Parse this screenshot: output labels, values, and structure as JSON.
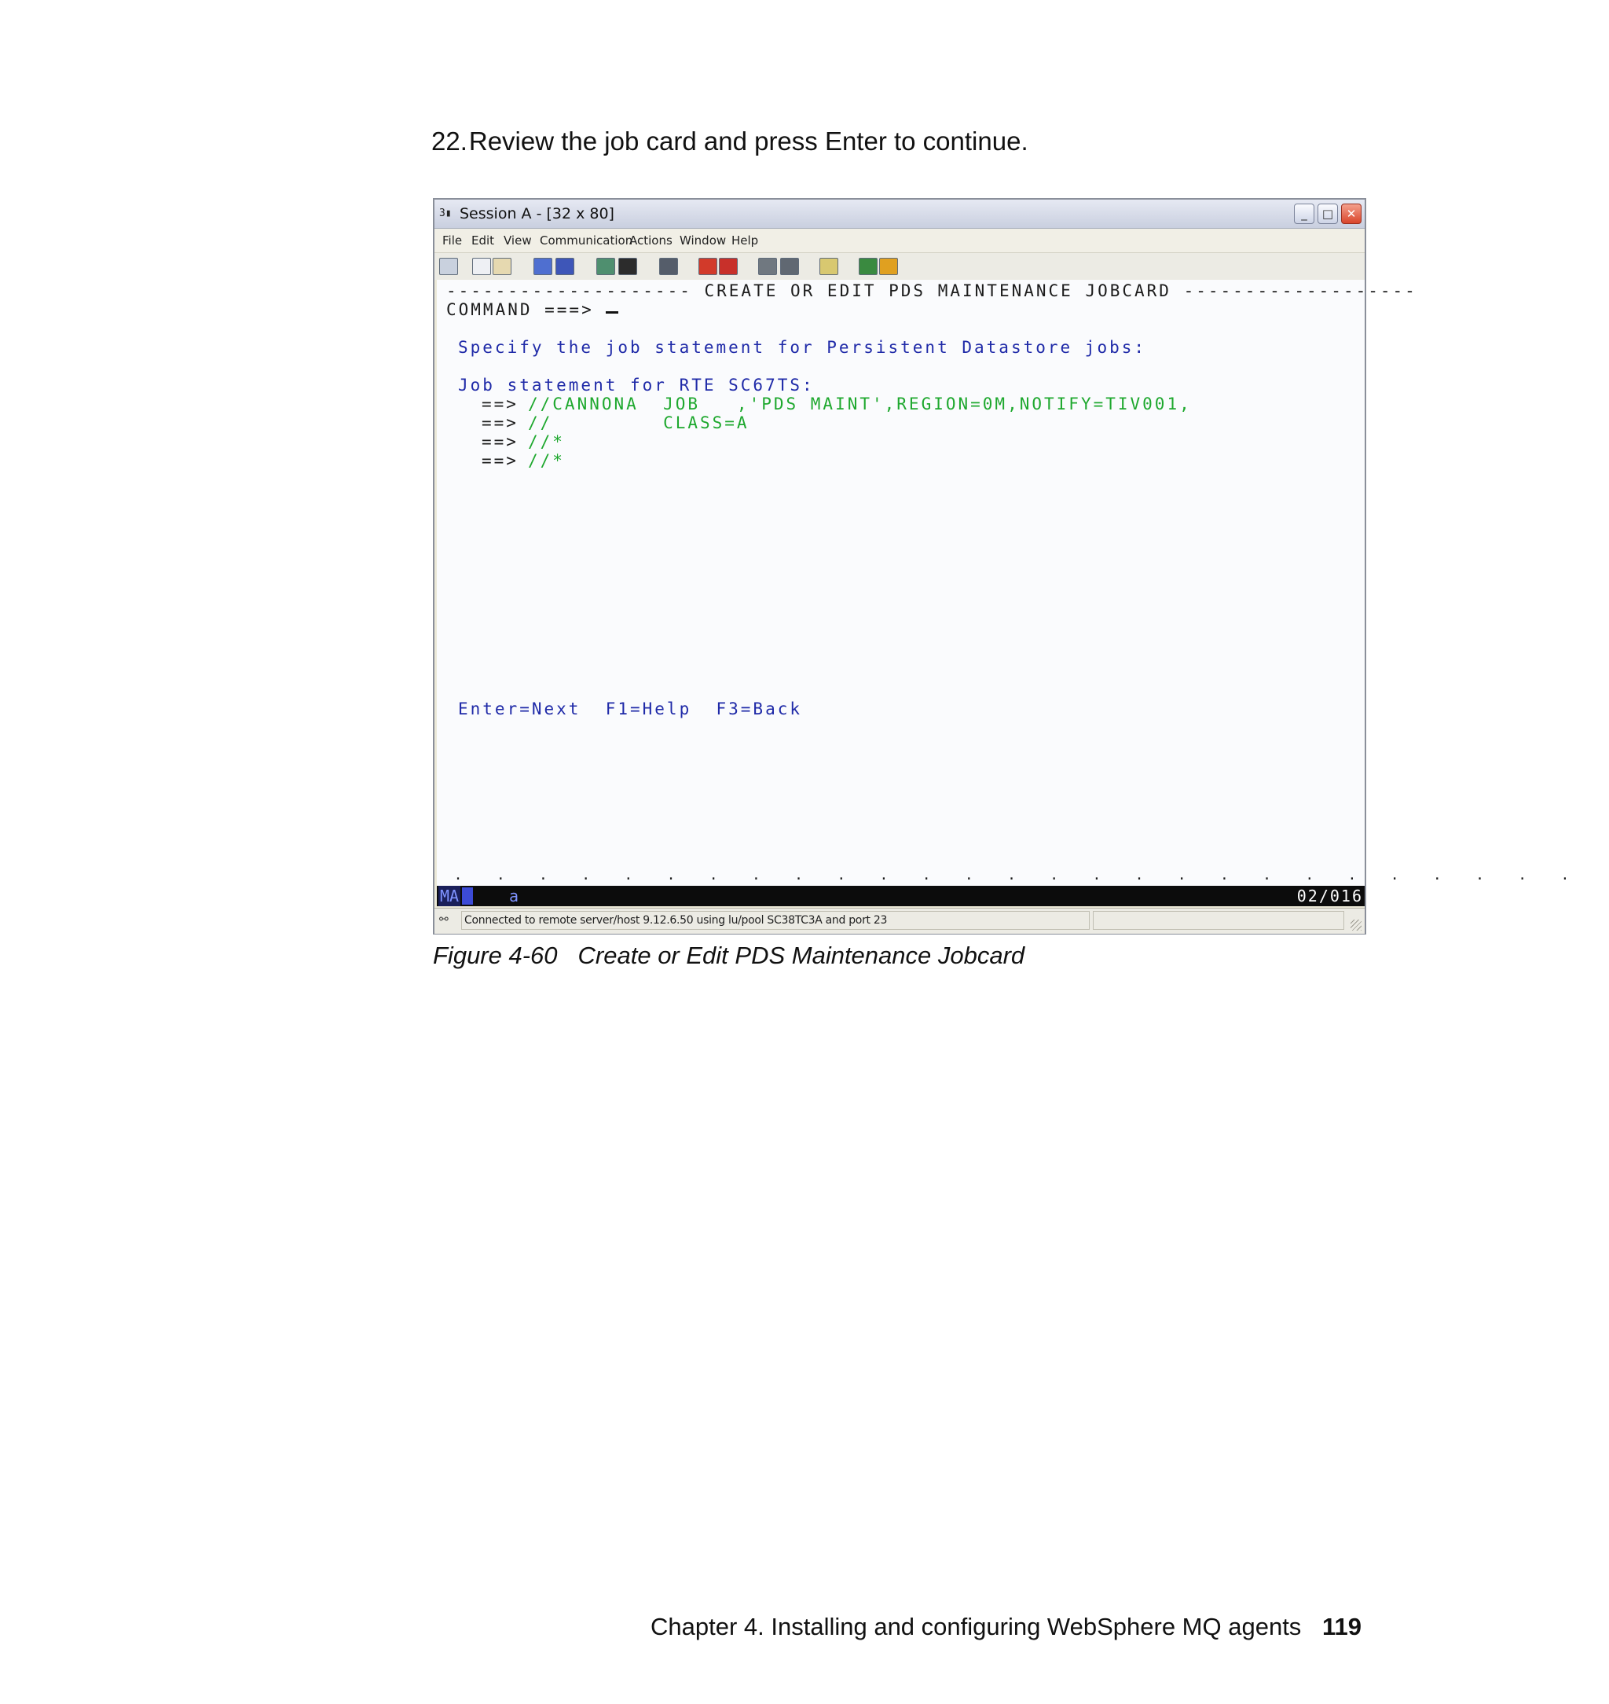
{
  "step": {
    "number": "22.",
    "text": "Review the job card and press Enter to continue."
  },
  "window": {
    "icon": "3270-session-icon",
    "title": "Session A - [32 x 80]",
    "controls": {
      "minimize": "minimize-icon",
      "maximize": "maximize-icon",
      "close": "close-icon"
    }
  },
  "menu": [
    "File",
    "Edit",
    "View",
    "Communication",
    "Actions",
    "Window",
    "Help"
  ],
  "toolbar": [
    "print-screen-icon",
    "copy-icon",
    "paste-icon",
    "send-file-icon",
    "receive-file-icon",
    "display-icon",
    "keypad-icon",
    "macro-icon",
    "record-macro-icon",
    "stop-macro-icon",
    "play-macro-icon",
    "run-macro-icon",
    "clipboard-icon",
    "web-icon",
    "help-icon"
  ],
  "screen": {
    "header": "-------------------- CREATE OR EDIT PDS MAINTENANCE JOBCARD -------------------",
    "command_label": "COMMAND ===>",
    "instruction": "Specify the job statement for Persistent Datastore jobs:",
    "job_statement_label": "Job statement for RTE SC67TS:",
    "job_lines": [
      {
        "prompt": "==>",
        "text": "//CANNONA  JOB   ,'PDS MAINT',REGION=0M,NOTIFY=TIV001,"
      },
      {
        "prompt": "==>",
        "text": "//         CLASS=A"
      },
      {
        "prompt": "==>",
        "text": "//*"
      },
      {
        "prompt": "==>",
        "text": "//*"
      }
    ],
    "function_keys": "Enter=Next  F1=Help  F3=Back"
  },
  "oia": {
    "mode": "MA",
    "indicator": "a",
    "cursor_position": "02/016"
  },
  "status_bar": {
    "message": "Connected to remote server/host 9.12.6.50 using lu/pool SC38TC3A and port 23"
  },
  "caption": {
    "figure": "Figure 4-60",
    "title": "Create or Edit PDS Maintenance Jobcard"
  },
  "footer": {
    "chapter": "Chapter 4. Installing and configuring WebSphere MQ agents",
    "page": "119"
  },
  "colors": {
    "blue_text": "#1f2aa8",
    "green_text": "#1ea82e",
    "oia_background": "#0c0c0c"
  }
}
